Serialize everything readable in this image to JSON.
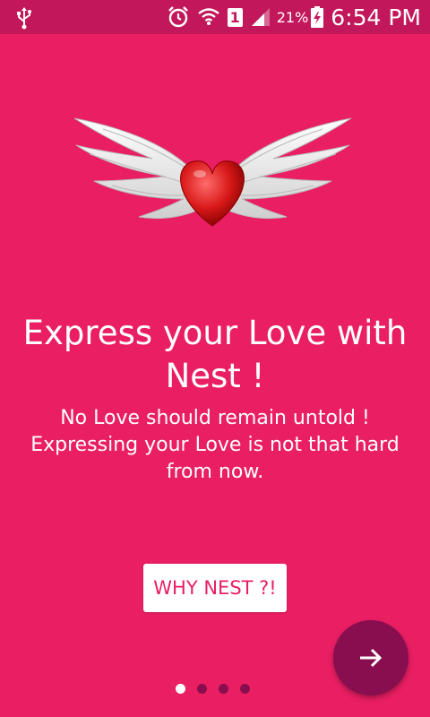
{
  "status_bar": {
    "battery_percent": "21%",
    "time": "6:54 PM",
    "sim_slot": "1",
    "icons": [
      "usb-icon",
      "alarm-icon",
      "wifi-icon",
      "sim-icon",
      "signal-icon",
      "battery-charging-icon"
    ]
  },
  "onboarding": {
    "headline_line1": "Express your Love with",
    "headline_line2": "Nest !",
    "sub_line1": "No Love should remain untold !",
    "sub_line2": "Expressing your Love is not that hard",
    "sub_line3": "from now.",
    "why_button_label": "WHY NEST ?!",
    "page_count": 4,
    "current_page": 1,
    "next_icon": "arrow-right-icon",
    "hero_image": "winged-heart"
  },
  "colors": {
    "background": "#e91e63",
    "status_bar": "#c2185b",
    "fab": "#880e4f",
    "dot_inactive": "#880e4f",
    "dot_active": "#ffffff"
  }
}
